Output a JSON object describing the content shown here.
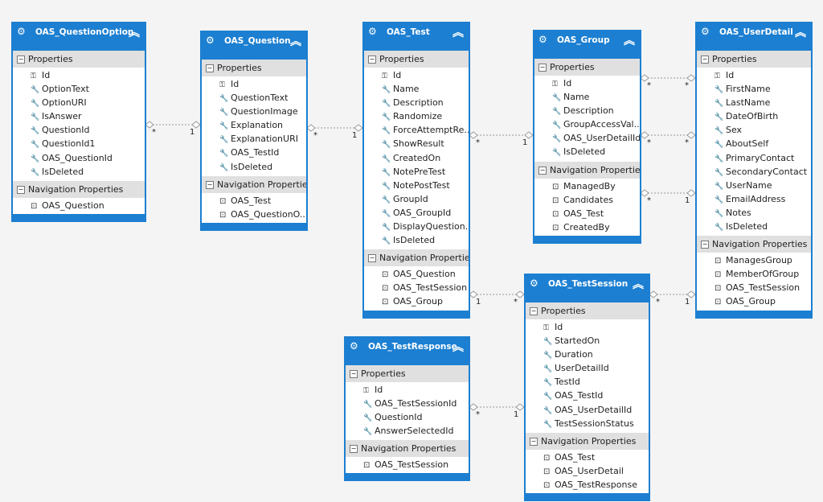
{
  "section_labels": {
    "properties": "Properties",
    "navigation": "Navigation Properties"
  },
  "icons": {
    "entity": "entity-icon",
    "collapse": "collapse-chevrons-icon",
    "key": "key-icon",
    "property": "wrench-icon",
    "navigation": "navigation-property-icon"
  },
  "colors": {
    "entity_header": "#1c7fd1",
    "section_header": "#e0e0e0",
    "background": "#f4f4f4"
  },
  "entities": [
    {
      "name": "OAS_QuestionOption",
      "properties": [
        "Id",
        "OptionText",
        "OptionURI",
        "IsAnswer",
        "QuestionId",
        "QuestionId1",
        "OAS_QuestionId",
        "IsDeleted"
      ],
      "navigation": [
        "OAS_Question"
      ]
    },
    {
      "name": "OAS_Question",
      "properties": [
        "Id",
        "QuestionText",
        "QuestionImage",
        "Explanation",
        "ExplanationURI",
        "OAS_TestId",
        "IsDeleted"
      ],
      "navigation": [
        "OAS_Test",
        "OAS_QuestionO..."
      ]
    },
    {
      "name": "OAS_Test",
      "properties": [
        "Id",
        "Name",
        "Description",
        "Randomize",
        "ForceAttemptRe...",
        "ShowResult",
        "CreatedOn",
        "NotePreTest",
        "NotePostTest",
        "GroupId",
        "OAS_GroupId",
        "DisplayQuestion...",
        "IsDeleted"
      ],
      "navigation": [
        "OAS_Question",
        "OAS_TestSession",
        "OAS_Group"
      ]
    },
    {
      "name": "OAS_Group",
      "properties": [
        "Id",
        "Name",
        "Description",
        "GroupAccessVal...",
        "OAS_UserDetailId",
        "IsDeleted"
      ],
      "navigation": [
        "ManagedBy",
        "Candidates",
        "OAS_Test",
        "CreatedBy"
      ]
    },
    {
      "name": "OAS_UserDetail",
      "properties": [
        "Id",
        "FirstName",
        "LastName",
        "DateOfBirth",
        "Sex",
        "AboutSelf",
        "PrimaryContact",
        "SecondaryContact",
        "UserName",
        "EmailAddress",
        "Notes",
        "IsDeleted"
      ],
      "navigation": [
        "ManagesGroup",
        "MemberOfGroup",
        "OAS_TestSession",
        "OAS_Group"
      ]
    },
    {
      "name": "OAS_TestSession",
      "properties": [
        "Id",
        "StartedOn",
        "Duration",
        "UserDetailId",
        "TestId",
        "OAS_TestId",
        "OAS_UserDetailId",
        "TestSessionStatus"
      ],
      "navigation": [
        "OAS_Test",
        "OAS_UserDetail",
        "OAS_TestResponse"
      ]
    },
    {
      "name": "OAS_TestResponse",
      "properties": [
        "Id",
        "OAS_TestSessionId",
        "QuestionId",
        "AnswerSelectedId"
      ],
      "navigation": [
        "OAS_TestSession"
      ]
    }
  ],
  "associations": [
    {
      "from": "OAS_QuestionOption",
      "to": "OAS_Question",
      "from_mult": "*",
      "to_mult": "1"
    },
    {
      "from": "OAS_Question",
      "to": "OAS_Test",
      "from_mult": "*",
      "to_mult": "1"
    },
    {
      "from": "OAS_Test",
      "to": "OAS_Group",
      "from_mult": "*",
      "to_mult": "1"
    },
    {
      "from": "OAS_Group",
      "to": "OAS_UserDetail",
      "from_mult": "*",
      "to_mult": "*"
    },
    {
      "from": "OAS_Group",
      "to": "OAS_UserDetail",
      "from_mult": "*",
      "to_mult": "*"
    },
    {
      "from": "OAS_Group",
      "to": "OAS_UserDetail",
      "from_mult": "*",
      "to_mult": "1"
    },
    {
      "from": "OAS_Test",
      "to": "OAS_TestSession",
      "from_mult": "1",
      "to_mult": "*"
    },
    {
      "from": "OAS_TestSession",
      "to": "OAS_UserDetail",
      "from_mult": "*",
      "to_mult": "1"
    },
    {
      "from": "OAS_TestResponse",
      "to": "OAS_TestSession",
      "from_mult": "*",
      "to_mult": "1"
    }
  ]
}
